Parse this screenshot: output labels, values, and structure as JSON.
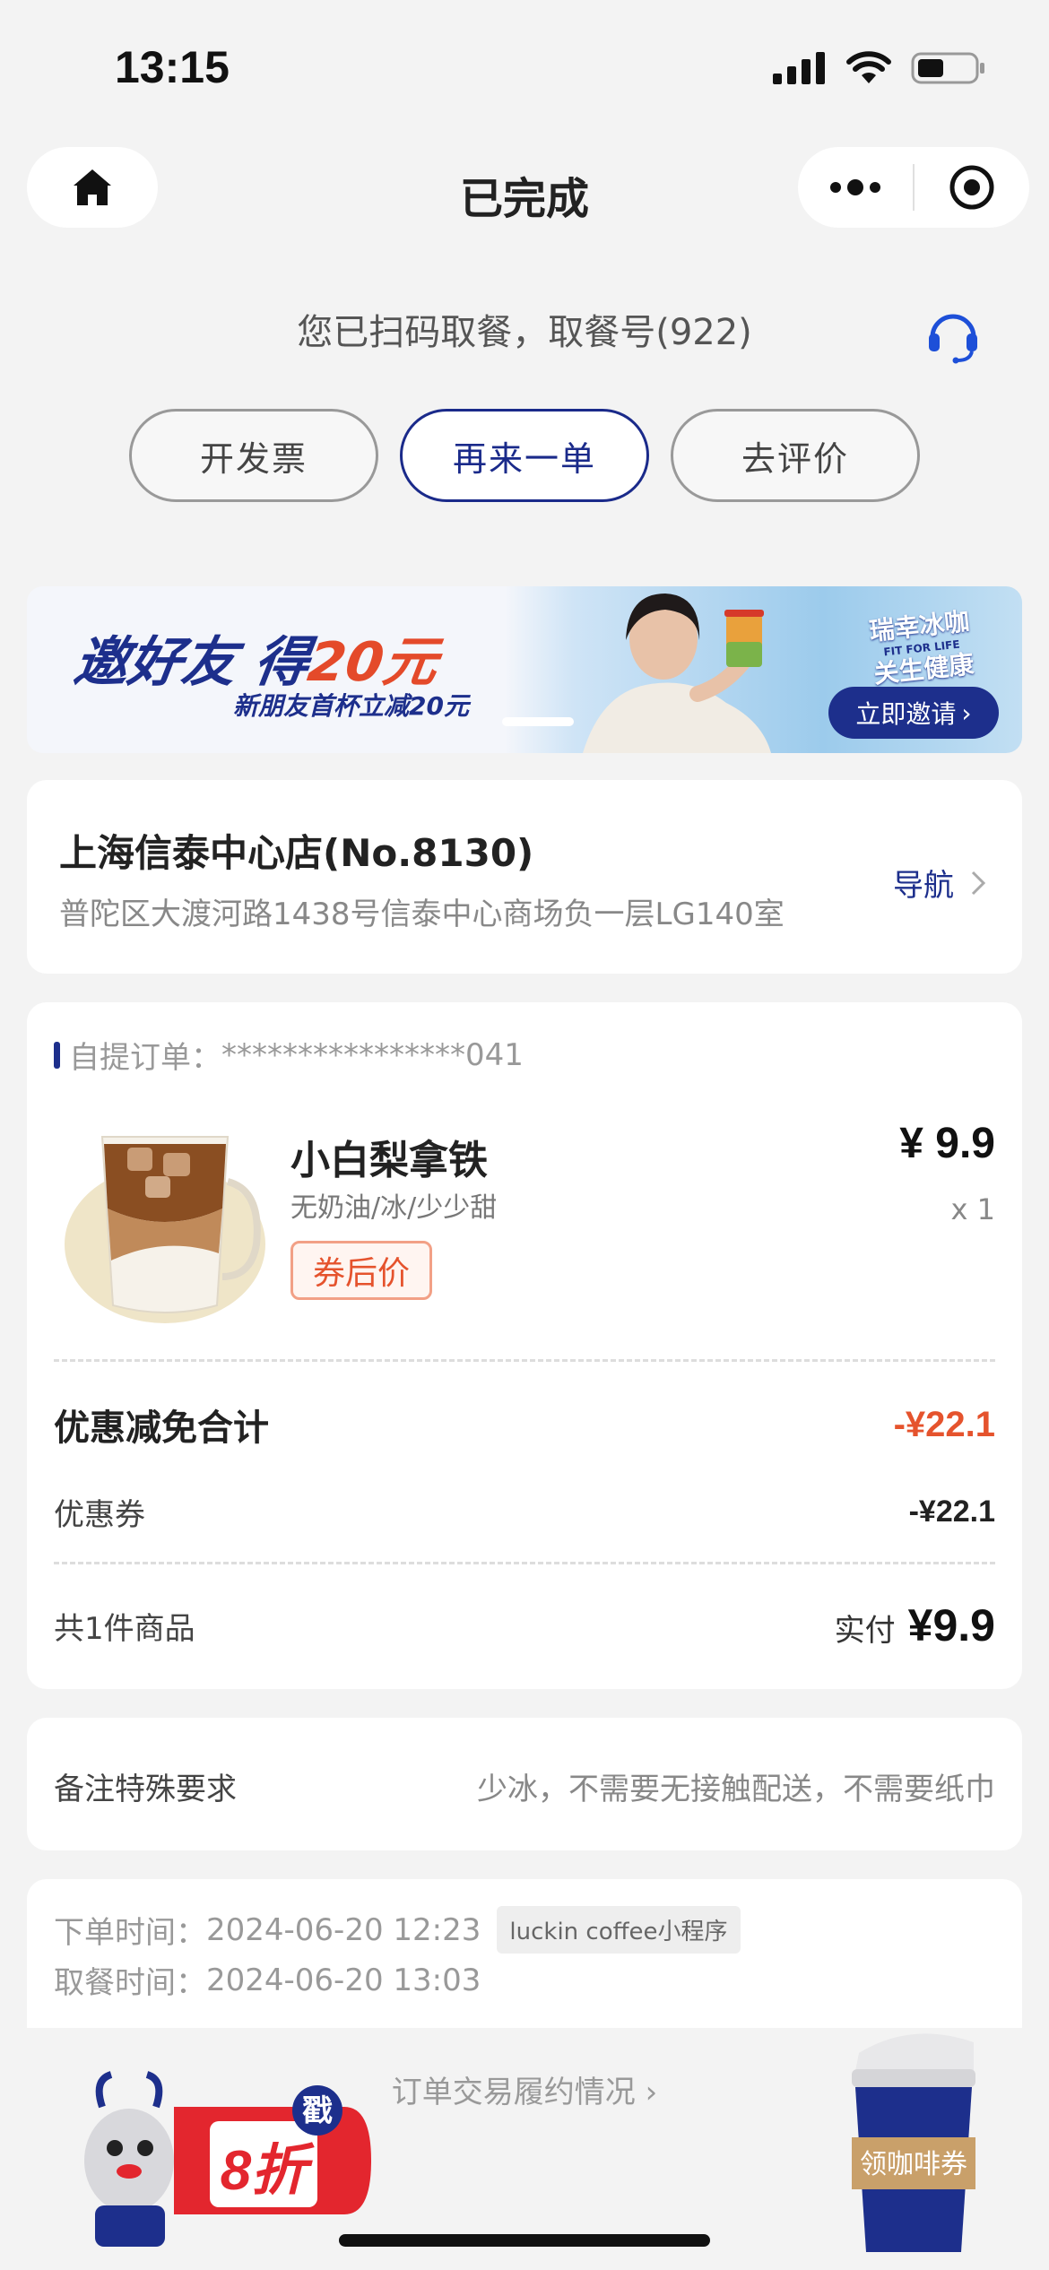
{
  "status_bar": {
    "time": "13:15"
  },
  "nav": {
    "title": "已完成"
  },
  "pickup": {
    "message": "您已扫码取餐，取餐号(922)"
  },
  "actions": {
    "invoice": "开发票",
    "reorder": "再来一单",
    "review": "去评价"
  },
  "banner": {
    "title_prefix": "邀好友 得",
    "title_amount": "20元",
    "subtitle": "新朋友首杯立减20元",
    "brand_line1": "瑞幸冰咖",
    "brand_line2": "关生健康",
    "brand_en": "FIT FOR LIFE",
    "cta": "立即邀请"
  },
  "store": {
    "name": "上海信泰中心店(No.8130)",
    "address": "普陀区大渡河路1438号信泰中心商场负一层LG140室",
    "nav_label": "导航"
  },
  "order": {
    "label": "自提订单：",
    "number": "****************041",
    "product": {
      "name": "小白梨拿铁",
      "spec": "无奶油/冰/少少甜",
      "tag": "券后价",
      "price": "¥ 9.9",
      "qty": "x 1"
    },
    "discount_total_label": "优惠减免合计",
    "discount_total": "-¥22.1",
    "coupon_label": "优惠券",
    "coupon_value": "-¥22.1",
    "count_label": "共1件商品",
    "paid_label": "实付",
    "paid_amount": "¥9.9"
  },
  "remark": {
    "label": "备注特殊要求",
    "value": "少冰，不需要无接触配送，不需要纸巾"
  },
  "times": {
    "order_label": "下单时间：",
    "order_time": "2024-06-20 12:23",
    "source": "luckin coffee小程序",
    "pickup_label": "取餐时间：",
    "pickup_time": "2024-06-20 13:03"
  },
  "footer": {
    "txn_link": "订单交易履约情况",
    "promo_left_badge": "戳",
    "promo_left_text": "8折",
    "promo_right_text": "领咖啡券"
  },
  "colors": {
    "brand": "#1d2f8c",
    "accent": "#e5532d",
    "background": "#f3f3f3"
  },
  "icons": [
    "home-icon",
    "more-icon",
    "target-icon",
    "headset-icon",
    "chevron-right-icon",
    "signal-icon",
    "wifi-icon",
    "battery-icon"
  ]
}
